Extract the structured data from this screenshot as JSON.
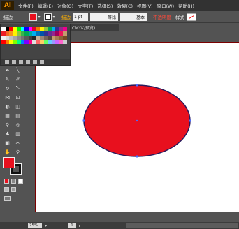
{
  "app": {
    "logo": "Ai"
  },
  "menu": [
    "文件(F)",
    "编辑(E)",
    "对象(O)",
    "文字(T)",
    "选择(S)",
    "效果(C)",
    "视图(V)",
    "窗口(W)",
    "帮助(H)"
  ],
  "control": {
    "label": "描边",
    "fill_color": "#e8101e",
    "stroke_weight": "1 pt",
    "profile_label": "等比",
    "brush_label": "基本",
    "opacity_label": "不透明度",
    "style_label": "样式"
  },
  "doc_tab": "CMYK/预览)",
  "swatches": [
    "#ffffff",
    "#000000",
    "#ff0000",
    "#ffff00",
    "#00ff00",
    "#00ffff",
    "#0000ff",
    "#ff00ff",
    "#e4002b",
    "#ef7d00",
    "#fff200",
    "#8dc63f",
    "#00a651",
    "#00aeef",
    "#2e3192",
    "#92278f",
    "#ec008c",
    "#ed1c24",
    "#f26522",
    "#f7941d",
    "#fff200",
    "#8dc63f",
    "#39b54a",
    "#00a651",
    "#00a99d",
    "#00aeef",
    "#0072bc",
    "#0054a6",
    "#2e3192",
    "#662d91",
    "#92278f",
    "#9e005d",
    "#ed145b",
    "#c69c6d",
    "#f0f0f0",
    "#d9d9d9",
    "#bfbfbf",
    "#a6a6a6",
    "#8c8c8c",
    "#737373",
    "#595959",
    "#404040",
    "#262626",
    "#c7b299",
    "#998675",
    "#736357",
    "#534741",
    "#c69c6d",
    "#a67c52",
    "#8c6239",
    "#754c24",
    "#ff0000",
    "#ff8000",
    "#ffff00",
    "#80ff00",
    "#00ff80",
    "#0080ff",
    "#8000ff",
    "#ff0080",
    "#e0e0e0",
    "#ff6666",
    "#ffcc66",
    "#66ff66",
    "#66ccff",
    "#9999ff",
    "#cc66ff",
    "#ff66cc",
    "#cccccc"
  ],
  "artwork": {
    "ellipse_fill": "#e8101e",
    "ellipse_stroke": "#2a1a5c"
  },
  "status": {
    "zoom": "75%",
    "page": "1"
  }
}
